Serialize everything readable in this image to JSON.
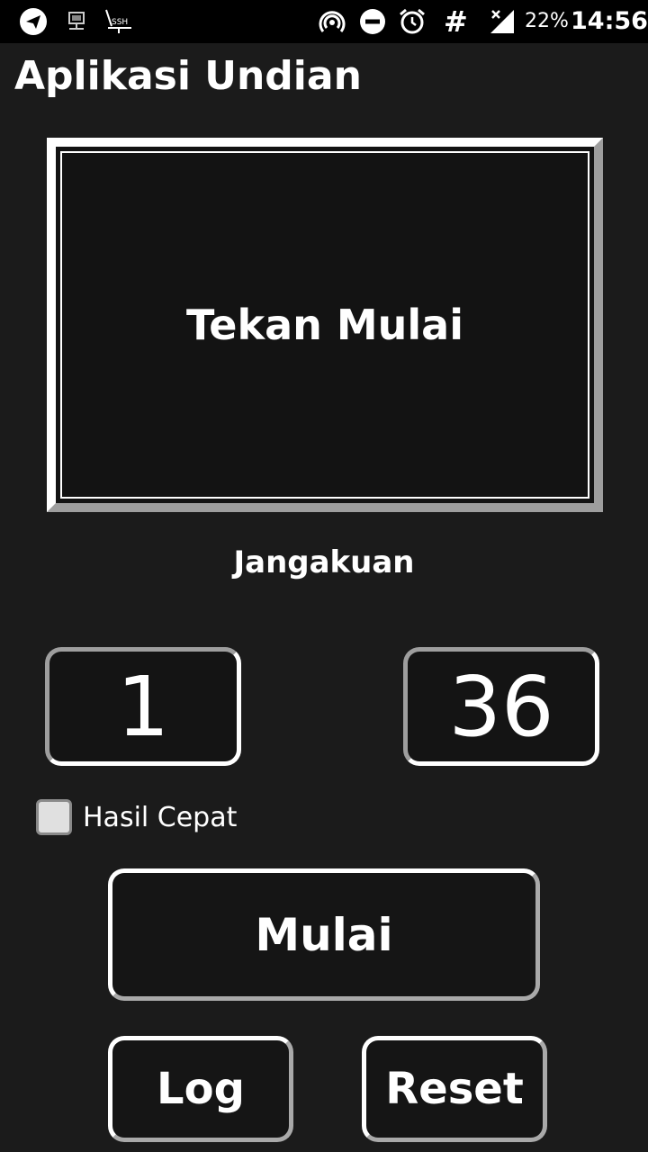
{
  "status_bar": {
    "icons": [
      "telegram-icon",
      "network-monitor-icon",
      "ssh-icon",
      "hotspot-icon",
      "do-not-disturb-icon",
      "alarm-icon",
      "hash-icon",
      "signal-icon"
    ],
    "battery": "22%",
    "time": "14:56"
  },
  "app": {
    "title": "Aplikasi Undian"
  },
  "display": {
    "text": "Tekan Mulai"
  },
  "range": {
    "label": "Jangakuan",
    "min": "1",
    "max": "36"
  },
  "options": {
    "quick_result_label": "Hasil Cepat",
    "quick_result_checked": false
  },
  "buttons": {
    "start_label": "Mulai",
    "log_label": "Log",
    "reset_label": "Reset"
  },
  "colors": {
    "background": "#1b1b1b",
    "status_bar": "#000000",
    "border_light": "#ffffff",
    "border_shadow": "#9e9e9e"
  }
}
